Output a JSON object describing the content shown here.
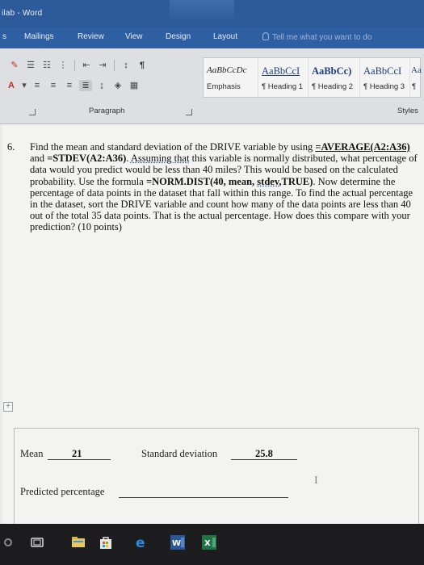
{
  "window": {
    "title": "ilab  -  Word"
  },
  "ribbon_tabs": [
    "s",
    "Mailings",
    "Review",
    "View",
    "Design",
    "Layout"
  ],
  "tell_me": {
    "placeholder": "Tell me what you want to do"
  },
  "styles": [
    {
      "sample": "AaBbCcDc",
      "name": "Emphasis"
    },
    {
      "sample": "AaBbCcI",
      "name": "¶ Heading 1"
    },
    {
      "sample": "AaBbCc)",
      "name": "¶ Heading 2"
    },
    {
      "sample": "AaBbCcI",
      "name": "¶ Heading 3"
    },
    {
      "sample": "Aa",
      "name": "¶"
    }
  ],
  "group_labels": {
    "paragraph": "Paragraph",
    "styles": "Styles"
  },
  "question": {
    "number": "6.",
    "text_1": "Find the mean and standard deviation of the DRIVE variable by using ",
    "formula_avg": "=AVERAGE(A2:A36)",
    "text_2": " and ",
    "formula_stdev": "=STDEV(A2:A36)",
    "text_3": ". ",
    "text_assuming": "Assuming that",
    "text_4": " this variable is normally distributed, what percentage of data would you predict would be less than 40 miles? This would be based on the calculated probability. Use the formula ",
    "formula_norm": "=NORM.DIST(40, mean, ",
    "formula_stdev_word": "stdev",
    "formula_true": ",TRUE)",
    "text_5": ". Now determine the percentage of data points in the dataset that fall within this range. To find the actual percentage in the dataset, sort the DRIVE variable and count how many of the data points are less than 40 out of the total 35 data points. That is the actual percentage. How does this compare with your prediction? (10 points)"
  },
  "answer_box": {
    "mean_label": "Mean",
    "mean_value": "21",
    "stdev_label": "Standard deviation",
    "stdev_value": "25.8",
    "predicted_label": "Predicted percentage"
  }
}
